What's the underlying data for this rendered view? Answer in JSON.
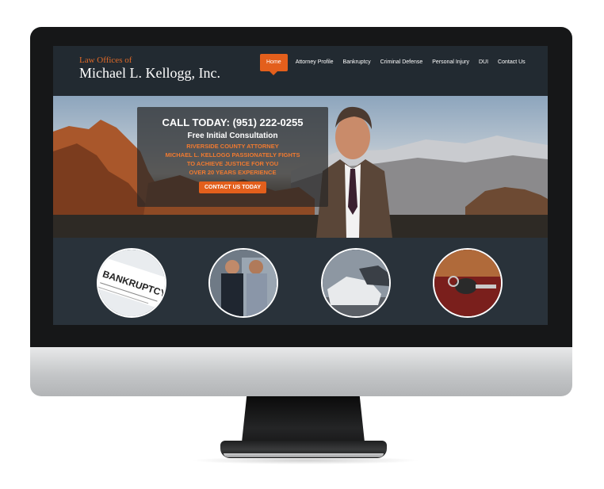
{
  "header": {
    "logo_line1": "Law Offices of",
    "logo_line2": "Michael L. Kellogg, Inc."
  },
  "nav": {
    "items": [
      {
        "label": "Home",
        "active": true
      },
      {
        "label": "Attorney Profile"
      },
      {
        "label": "Bankruptcy"
      },
      {
        "label": "Criminal Defense"
      },
      {
        "label": "Personal Injury"
      },
      {
        "label": "DUI"
      },
      {
        "label": "Contact Us"
      }
    ]
  },
  "hero": {
    "phone": "CALL TODAY: (951) 222-0255",
    "consultation": "Free Initial Consultation",
    "lines": [
      "RIVERSIDE COUNTY ATTORNEY",
      "MICHAEL L. KELLOGG PASSIONATELY FIGHTS",
      "TO ACHIEVE JUSTICE FOR YOU",
      "OVER 20 YEARS EXPERIENCE"
    ],
    "cta_label": "CONTACT US TODAY"
  },
  "services": {
    "circles": [
      {
        "icon": "bankruptcy-form-image",
        "label": "BANKRUPTCY"
      },
      {
        "icon": "police-arrest-image"
      },
      {
        "icon": "car-accident-image"
      },
      {
        "icon": "dui-keys-image"
      }
    ]
  },
  "colors": {
    "accent": "#e35f1c",
    "header_bg": "#222a31",
    "services_bg": "#29323a"
  }
}
